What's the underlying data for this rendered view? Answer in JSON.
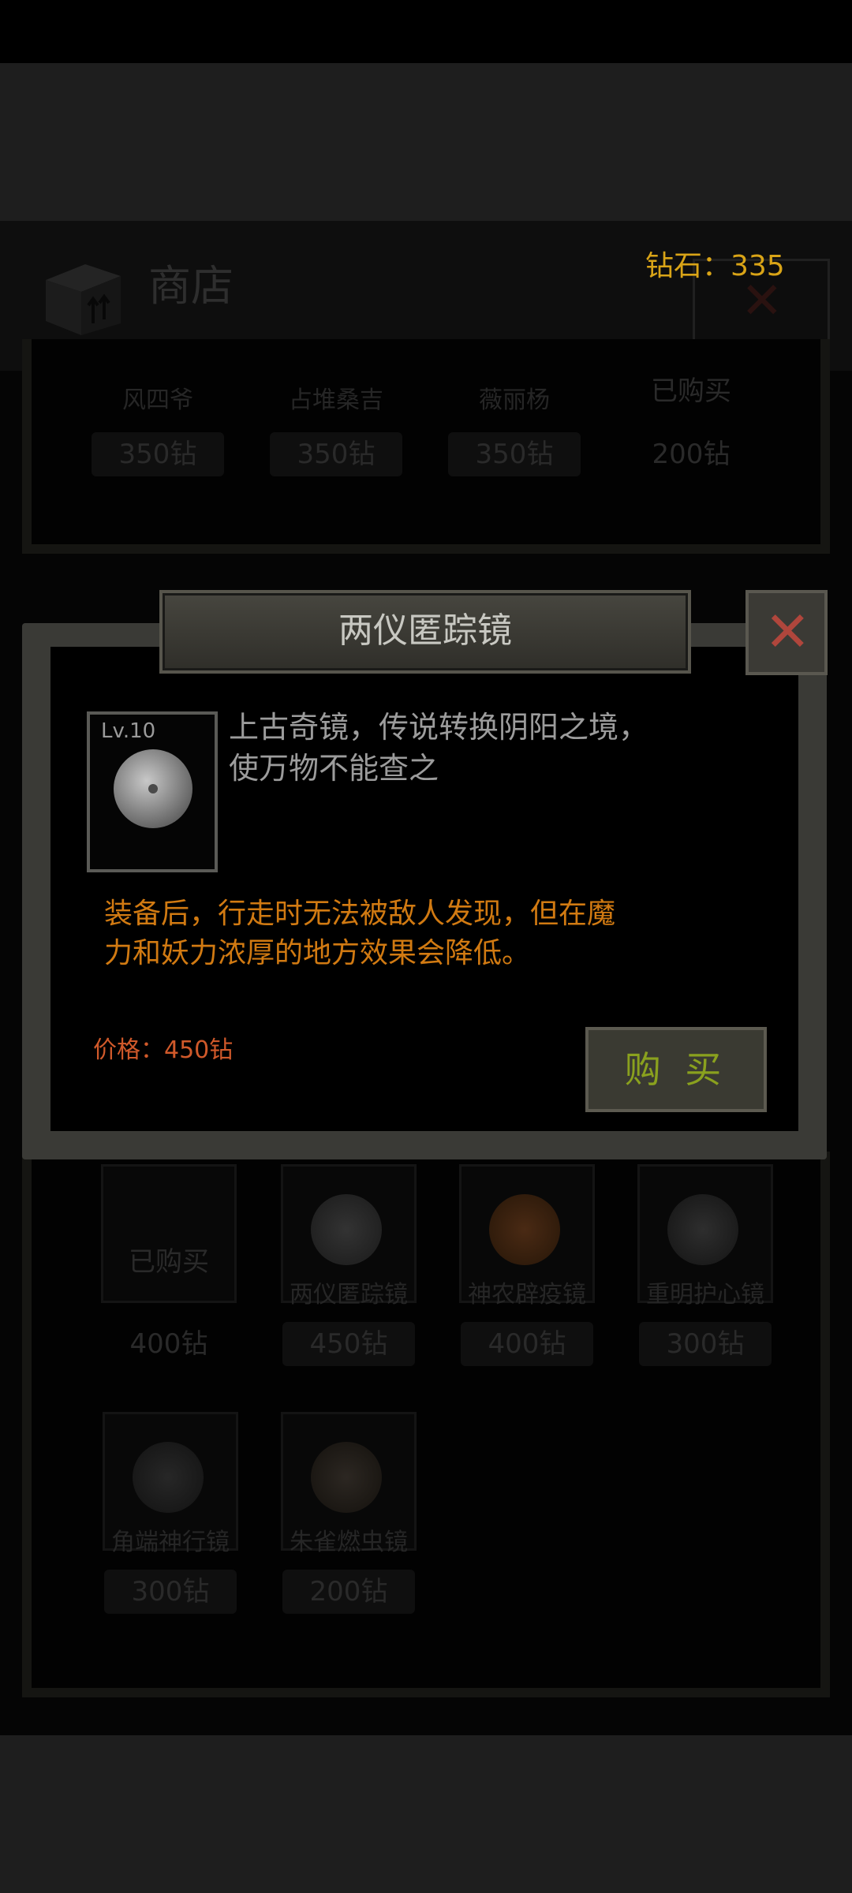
{
  "shop": {
    "title": "商店",
    "diamonds": "钻石：335",
    "top_row": [
      {
        "name": "风四爷",
        "price": "350钻"
      },
      {
        "name": "占堆桑吉",
        "price": "350钻"
      },
      {
        "name": "薇丽杨",
        "price": "350钻"
      },
      {
        "name": "",
        "price": "200钻",
        "status": "已购买"
      }
    ],
    "bottom_rows": [
      {
        "name": "",
        "price": "400钻",
        "status": "已购买"
      },
      {
        "name": "两仪匿踪镜",
        "price": "450钻"
      },
      {
        "name": "神农辟疫镜",
        "price": "400钻"
      },
      {
        "name": "重明护心镜",
        "price": "300钻"
      },
      {
        "name": "角端神行镜",
        "price": "300钻"
      },
      {
        "name": "朱雀燃虫镜",
        "price": "200钻"
      }
    ]
  },
  "modal": {
    "title": "两仪匿踪镜",
    "close_icon": "close-icon",
    "level": "Lv.10",
    "description_line1": "上古奇镜，传说转换阴阳之境，",
    "description_line2": "使万物不能查之",
    "effect_line1": "装备后，行走时无法被敌人发现，但在魔",
    "effect_line2": "力和妖力浓厚的地方效果会降低。",
    "price": "价格：450钻",
    "buy_label": "购 买"
  },
  "colors": {
    "accent_orange": "#d17a12",
    "price_red": "#d0592a",
    "buy_green": "#8aa11e",
    "diamond_gold": "#d9a417",
    "close_red": "#b0463c"
  }
}
